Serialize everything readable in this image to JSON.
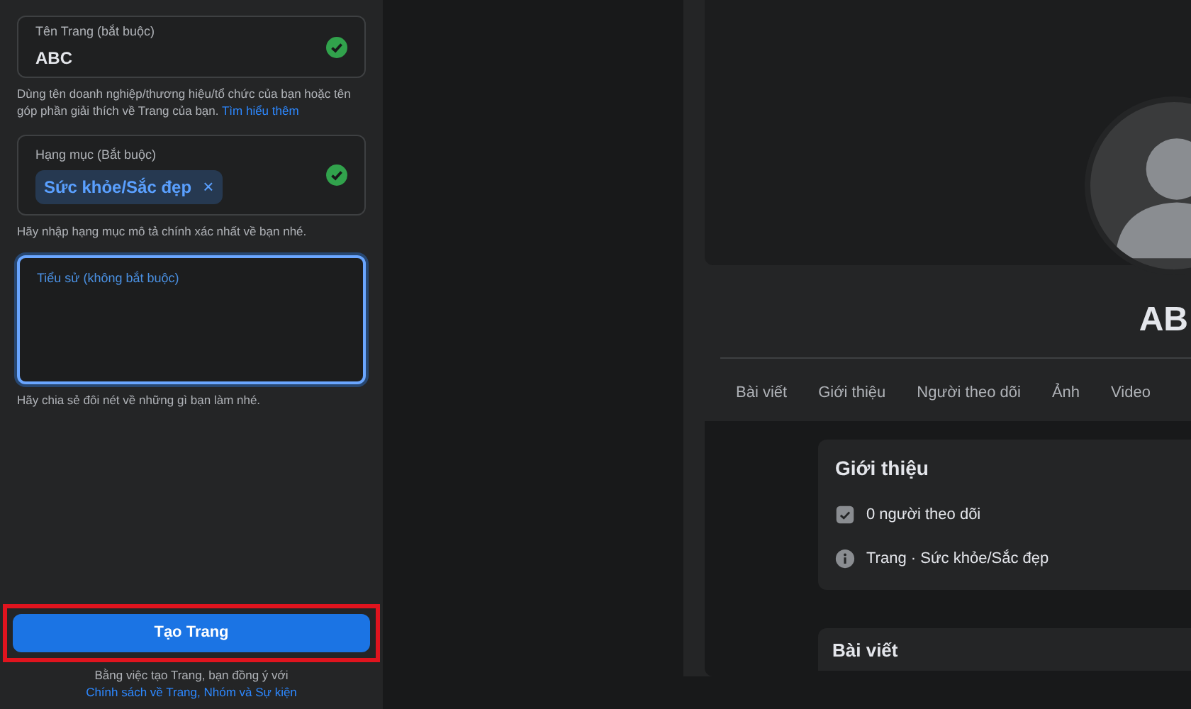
{
  "form": {
    "fields": [
      {
        "kind": "text",
        "label": "Tên Trang (bắt buộc)",
        "value": "ABC",
        "valid": true,
        "help": "Dùng tên doanh nghiệp/thương hiệu/tổ chức của bạn hoặc tên góp phần giải thích về Trang của bạn.",
        "help_link": "Tìm hiểu thêm"
      },
      {
        "kind": "chips",
        "label": "Hạng mục (Bắt buộc)",
        "chips": [
          "Sức khỏe/Sắc đẹp"
        ],
        "chip_remove": "×",
        "valid": true,
        "help": "Hãy nhập hạng mục mô tả chính xác nhất về bạn nhé."
      },
      {
        "kind": "textarea",
        "label": "Tiểu sử (không bắt buộc)",
        "focused": true,
        "help": "Hãy chia sẻ đôi nét về những gì bạn làm nhé."
      }
    ],
    "submit": {
      "label": "Tạo Trang",
      "highlighted": true
    },
    "terms": {
      "text": "Bằng việc tạo Trang, bạn đồng ý với",
      "link": "Chính sách về Trang, Nhóm và Sự kiện"
    }
  },
  "preview": {
    "name": "AB",
    "tabs": [
      "Bài viết",
      "Giới thiệu",
      "Người theo dõi",
      "Ảnh",
      "Video"
    ],
    "intro": {
      "title": "Giới thiệu",
      "items": [
        {
          "kind": "followers",
          "text": "0 người theo dõi"
        },
        {
          "kind": "info",
          "text": "Trang · Sức khỏe/Sắc đẹp"
        }
      ]
    },
    "posts_title": "Bài viết"
  }
}
